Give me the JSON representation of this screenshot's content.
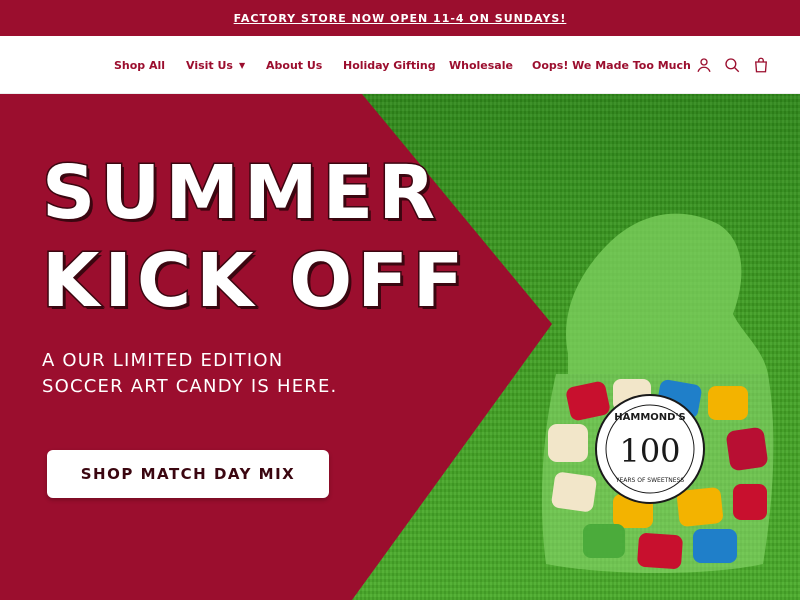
{
  "announcement": {
    "text": "FACTORY STORE NOW OPEN 11-4 ON SUNDAYS!"
  },
  "nav": {
    "links": [
      {
        "label": "Shop All"
      },
      {
        "label": "Visit Us",
        "has_dropdown": true
      },
      {
        "label": "About Us"
      },
      {
        "label": "Holiday Gifting"
      },
      {
        "label": "Wholesale"
      },
      {
        "label": "Oops! We Made Too Much"
      }
    ],
    "icons": [
      "user-icon",
      "search-icon",
      "bag-icon"
    ]
  },
  "hero": {
    "headline_line1": "SUMMER",
    "headline_line2": "KICK OFF",
    "subtitle_line1": "A OUR LIMITED EDITION",
    "subtitle_line2": "SOCCER ART CANDY IS HERE.",
    "cta_label": "SHOP MATCH DAY MIX",
    "badge": {
      "brand": "HAMMOND'S",
      "number": "100",
      "tagline": "YEARS OF SWEETNESS"
    }
  },
  "colors": {
    "brand_red": "#9b0e2e",
    "dark_outline": "#3b0610",
    "grass_green": "#3f9f22"
  }
}
